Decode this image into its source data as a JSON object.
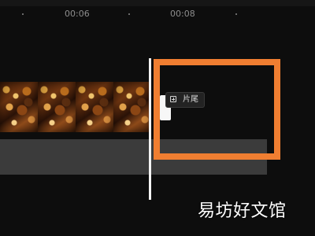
{
  "timeline": {
    "time_markers": [
      "00:06",
      "00:08"
    ]
  },
  "ending_button": {
    "label": "片尾",
    "icon": "add-square-icon"
  },
  "watermark": {
    "text": "易坊好文馆"
  },
  "colors": {
    "background": "#0d0d0d",
    "highlight": "#f07e31",
    "playhead": "#f4f4f4",
    "track": "#3b3b3b"
  }
}
